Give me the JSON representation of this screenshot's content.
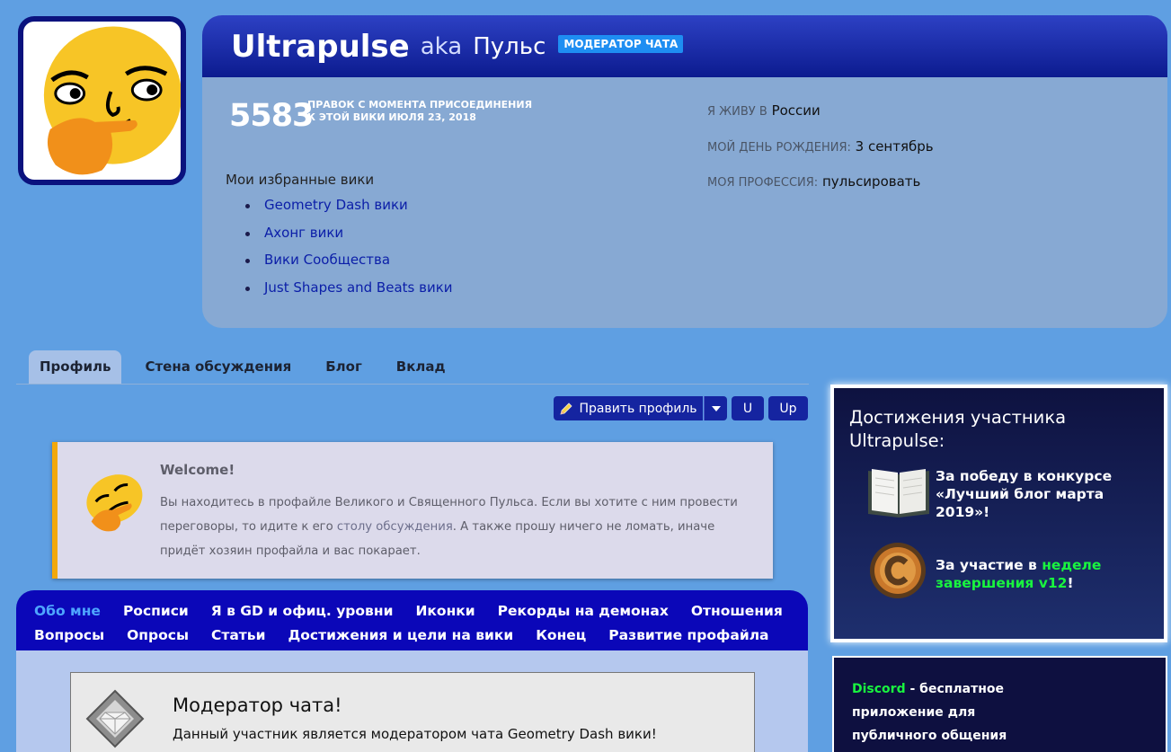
{
  "profile": {
    "username": "Ultrapulse",
    "aka_label": "aka",
    "aka_name": "Пульс",
    "badge": "МОДЕРАТОР ЧАТА",
    "edits_count": "5583",
    "edits_label_line1": "ПРАВОК С МОМЕНТА ПРИСОЕДИНЕНИЯ",
    "edits_label_line2": "К ЭТОЙ ВИКИ ИЮЛЯ 23, 2018",
    "favorites_title": "Мои избранные вики",
    "favorites": [
      "Geometry Dash вики",
      "Ахонг вики",
      "Вики Сообщества",
      "Just Shapes and Beats вики"
    ],
    "info": {
      "location_key": "Я ЖИВУ В",
      "location_value": "России",
      "birthday_key": "МОЙ ДЕНЬ РОЖДЕНИЯ:",
      "birthday_value": "3 сентябрь",
      "job_key": "МОЯ ПРОФЕССИЯ:",
      "job_value": "пульсировать"
    }
  },
  "tabs": [
    "Профиль",
    "Стена обсуждения",
    "Блог",
    "Вклад"
  ],
  "toolbar": {
    "edit_label": "Править профиль",
    "u_label": "U",
    "up_label": "Up"
  },
  "welcome": {
    "title": "Welcome!",
    "text_part1": "Вы находитесь в профайле Великого и Священного Пульса. Если вы хотите с ним провести переговоры, то идите к его ",
    "link_text": "столу обсуждения",
    "text_part2": ". А также прошу ничего не ломать, иначе придёт хозяин профайла и вас покарает."
  },
  "section_nav": {
    "row1": [
      "Обо мне",
      "Росписи",
      "Я в GD и офиц. уровни",
      "Иконки",
      "Рекорды на демонах",
      "Отношения"
    ],
    "row2": [
      "Вопросы",
      "Опросы",
      "Статьи",
      "Достижения и цели на вики",
      "Конец",
      "Развитие профайла"
    ]
  },
  "moderator": {
    "title": "Модератор чата!",
    "text": "Данный участник является модератором чата Geometry Dash вики!"
  },
  "achievements": {
    "title": "Достижения участника Ultrapulse:",
    "item1": "За победу в конкурсе «Лучший блог марта 2019»!",
    "item2_prefix": "За участие в ",
    "item2_link": "неделе завершения v12",
    "item2_suffix": "!"
  },
  "discord": {
    "name": "Discord",
    "text": " - бесплатное приложение для публичного общения"
  },
  "colors": {
    "background": "#5f9fe2",
    "header_blue": "#0c1b8f",
    "nav_blue": "#0b07b8",
    "accent_orange": "#f2a80b",
    "link_green": "#19f43f"
  }
}
